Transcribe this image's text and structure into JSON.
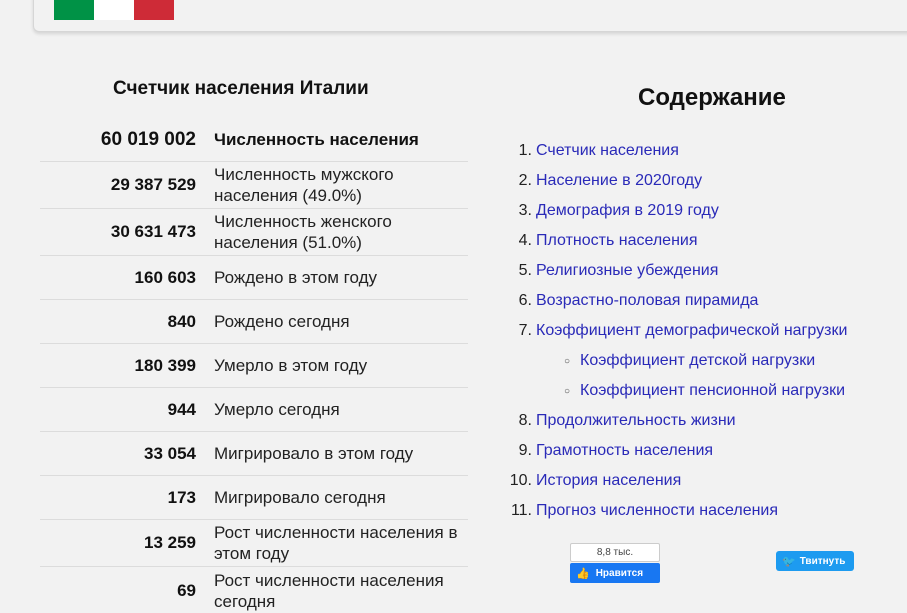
{
  "counter": {
    "title": "Счетчик населения Италии",
    "rows": [
      {
        "value": "60 019 002",
        "label": "Численность населения"
      },
      {
        "value": "29 387 529",
        "label": "Численность мужского населения (49.0%)"
      },
      {
        "value": "30 631 473",
        "label": "Численность женского населения (51.0%)"
      },
      {
        "value": "160 603",
        "label": "Рождено в этом году"
      },
      {
        "value": "840",
        "label": "Рождено сегодня"
      },
      {
        "value": "180 399",
        "label": "Умерло в этом году"
      },
      {
        "value": "944",
        "label": "Умерло сегодня"
      },
      {
        "value": "33 054",
        "label": "Мигрировало в этом году"
      },
      {
        "value": "173",
        "label": "Мигрировало сегодня"
      },
      {
        "value": "13 259",
        "label": "Рост численности населения в этом году"
      },
      {
        "value": "69",
        "label": "Рост численности населения сегодня"
      }
    ]
  },
  "flag": {
    "colors": [
      "#009246",
      "#ffffff",
      "#ce2b37"
    ]
  },
  "toc": {
    "title": "Содержание",
    "items": [
      {
        "num": "1.",
        "text": "Счетчик населения"
      },
      {
        "num": "2.",
        "text": "Население в 2020году"
      },
      {
        "num": "3.",
        "text": "Демография в 2019 году"
      },
      {
        "num": "4.",
        "text": "Плотность населения"
      },
      {
        "num": "5.",
        "text": "Религиозные убеждения"
      },
      {
        "num": "6.",
        "text": "Возрастно-половая пирамида"
      },
      {
        "num": "7.",
        "text": "Коэффициент демографической нагрузки"
      },
      {
        "num": "8.",
        "text": "Продолжительность жизни"
      },
      {
        "num": "9.",
        "text": "Грамотность населения"
      },
      {
        "num": "10.",
        "text": "История населения"
      },
      {
        "num": "11.",
        "text": "Прогноз численности населения"
      }
    ],
    "subitems": [
      {
        "text": "Коэффициент детской нагрузки"
      },
      {
        "text": "Коэффициент пенсионной нагрузки"
      }
    ]
  },
  "social": {
    "fb_count": "8,8 тыс.",
    "fb_label": "Нравится",
    "tw_label": "Твитнуть"
  }
}
